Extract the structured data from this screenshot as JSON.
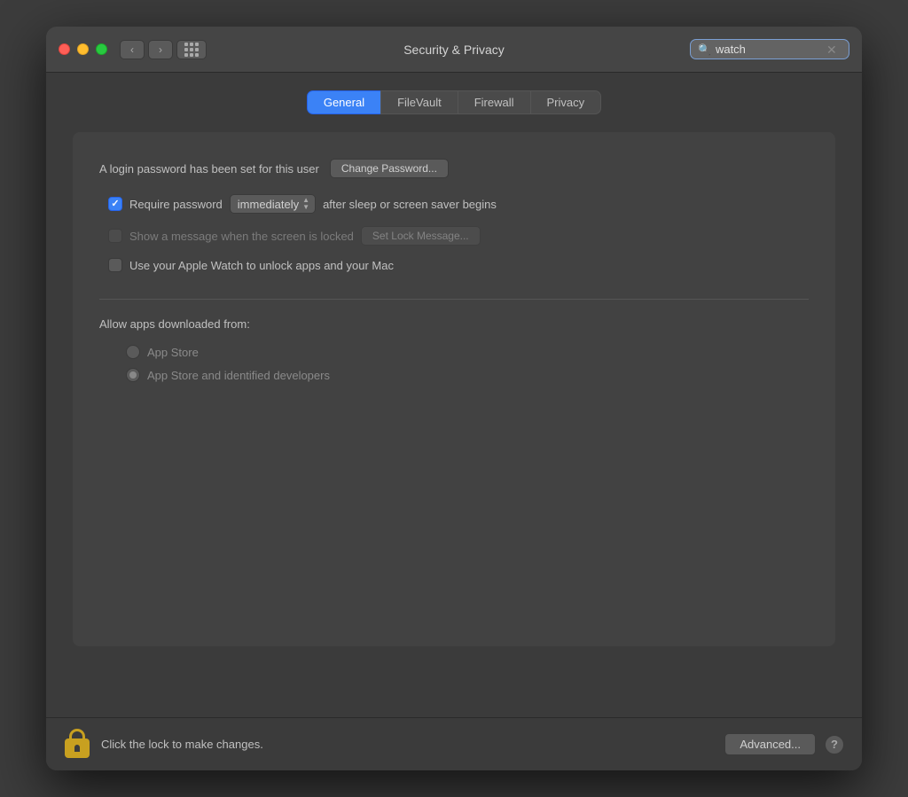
{
  "window": {
    "title": "Security & Privacy"
  },
  "titlebar": {
    "back_label": "‹",
    "forward_label": "›",
    "search_placeholder": "watch",
    "search_value": "watch"
  },
  "tabs": [
    {
      "id": "general",
      "label": "General",
      "active": true
    },
    {
      "id": "filevault",
      "label": "FileVault",
      "active": false
    },
    {
      "id": "firewall",
      "label": "Firewall",
      "active": false
    },
    {
      "id": "privacy",
      "label": "Privacy",
      "active": false
    }
  ],
  "general": {
    "login_password_text": "A login password has been set for this user",
    "change_password_label": "Change Password...",
    "require_password_label": "Require password",
    "immediately_label": "immediately",
    "after_sleep_label": "after sleep or screen saver begins",
    "show_message_label": "Show a message when the screen is locked",
    "set_lock_message_label": "Set Lock Message...",
    "apple_watch_label": "Use your Apple Watch to unlock apps and your Mac",
    "allow_apps_label": "Allow apps downloaded from:",
    "app_store_label": "App Store",
    "app_store_identified_label": "App Store and identified developers"
  },
  "bottom": {
    "lock_text": "Click the lock to make changes.",
    "advanced_label": "Advanced...",
    "help_label": "?"
  },
  "colors": {
    "active_tab": "#3b82f6",
    "checkbox_checked": "#3b82f6",
    "lock_gold": "#c8a020"
  }
}
